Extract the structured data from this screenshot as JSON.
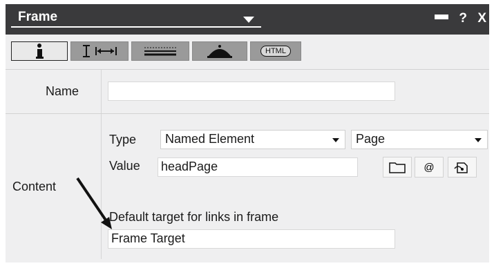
{
  "panel": {
    "title": "Frame",
    "window_controls": {
      "help": "?",
      "close": "X"
    }
  },
  "tabs": [
    {
      "name": "info",
      "icon": "info-icon"
    },
    {
      "name": "spacing",
      "icon": "spacing-icon"
    },
    {
      "name": "borders",
      "icon": "lines-icon"
    },
    {
      "name": "events",
      "icon": "bell-icon"
    },
    {
      "name": "html",
      "label": "HTML",
      "icon": "html-icon"
    }
  ],
  "name_row": {
    "label": "Name",
    "value": ""
  },
  "content": {
    "label": "Content",
    "type_label": "Type",
    "type_value": "Named Element",
    "element_value": "Page",
    "value_label": "Value",
    "value_text": "headPage",
    "target_label": "Default target for links in frame",
    "target_value": "Frame Target"
  }
}
